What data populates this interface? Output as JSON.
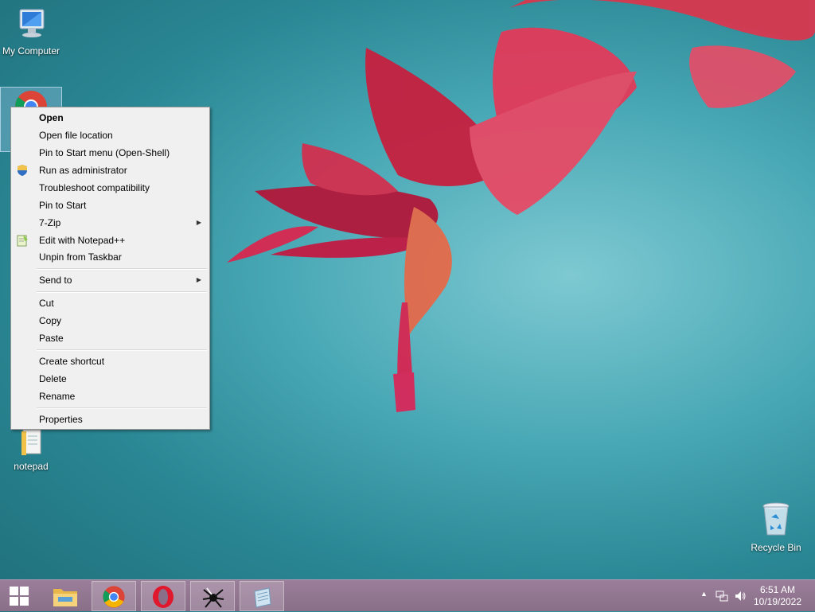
{
  "desktop": {
    "icons": [
      {
        "label": "My Computer"
      },
      {
        "label": "notepad"
      },
      {
        "label": "Recycle Bin"
      }
    ]
  },
  "context_menu": {
    "items": [
      {
        "label": "Open",
        "bold": true
      },
      {
        "label": "Open file location"
      },
      {
        "label": "Pin to Start menu (Open-Shell)"
      },
      {
        "label": "Run as administrator",
        "icon": "shield-icon"
      },
      {
        "label": "Troubleshoot compatibility"
      },
      {
        "label": "Pin to Start"
      },
      {
        "label": "7-Zip",
        "submenu": true
      },
      {
        "label": "Edit with Notepad++",
        "icon": "notepad-plus-plus-icon"
      },
      {
        "label": "Unpin from Taskbar"
      },
      {
        "label": "Send to",
        "submenu": true
      },
      {
        "label": "Cut"
      },
      {
        "label": "Copy"
      },
      {
        "label": "Paste"
      },
      {
        "label": "Create shortcut"
      },
      {
        "label": "Delete"
      },
      {
        "label": "Rename"
      },
      {
        "label": "Properties"
      }
    ]
  },
  "taskbar": {
    "buttons": [
      "start-button",
      "file-explorer",
      "chrome",
      "opera",
      "app-spider",
      "app-notepad"
    ],
    "tray": {
      "time": "6:51 AM",
      "date": "10/19/2022"
    }
  }
}
